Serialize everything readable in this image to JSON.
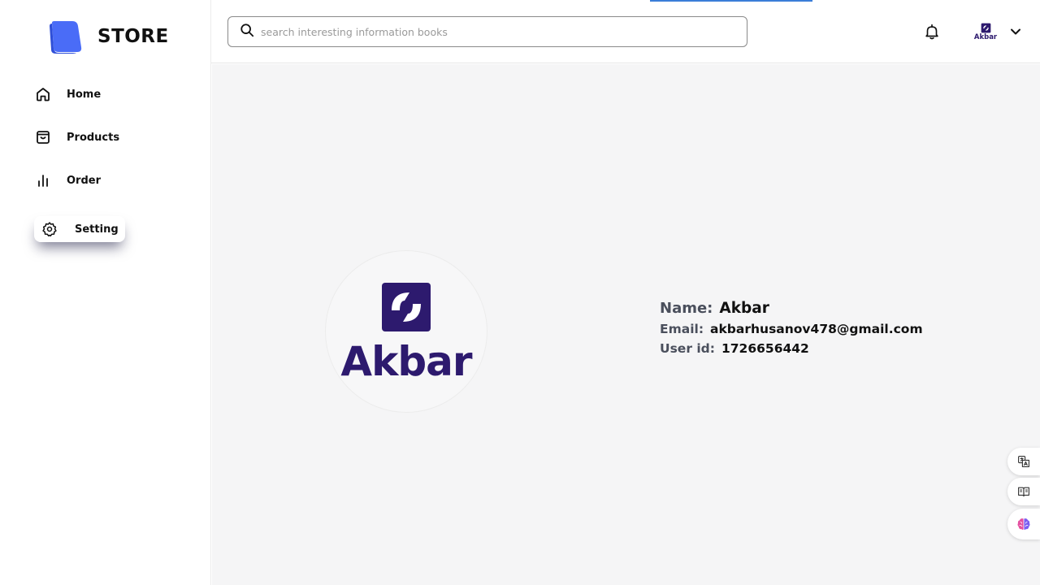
{
  "brand": {
    "name": "STORE",
    "accent_color": "#4a6cf7"
  },
  "sidebar": {
    "items": [
      {
        "label": "Home",
        "icon": "home-icon"
      },
      {
        "label": "Products",
        "icon": "shopping-bag-icon"
      },
      {
        "label": "Order",
        "icon": "bar-chart-icon"
      },
      {
        "label": "Setting",
        "icon": "gear-icon",
        "active": true
      }
    ]
  },
  "header": {
    "search": {
      "placeholder": "search interesting information books",
      "value": ""
    },
    "avatar_text": "Akbar"
  },
  "profile": {
    "avatar_text": "Akbar",
    "name_label": "Name:",
    "name": "Akbar",
    "email_label": "Email:",
    "email": "akbarhusanov478@gmail.com",
    "uid_label": "User id:",
    "uid": "1726656442",
    "logo_color": "#2d1a6e"
  },
  "floating_tools": [
    "translate-icon",
    "reader-icon",
    "brain-icon"
  ]
}
